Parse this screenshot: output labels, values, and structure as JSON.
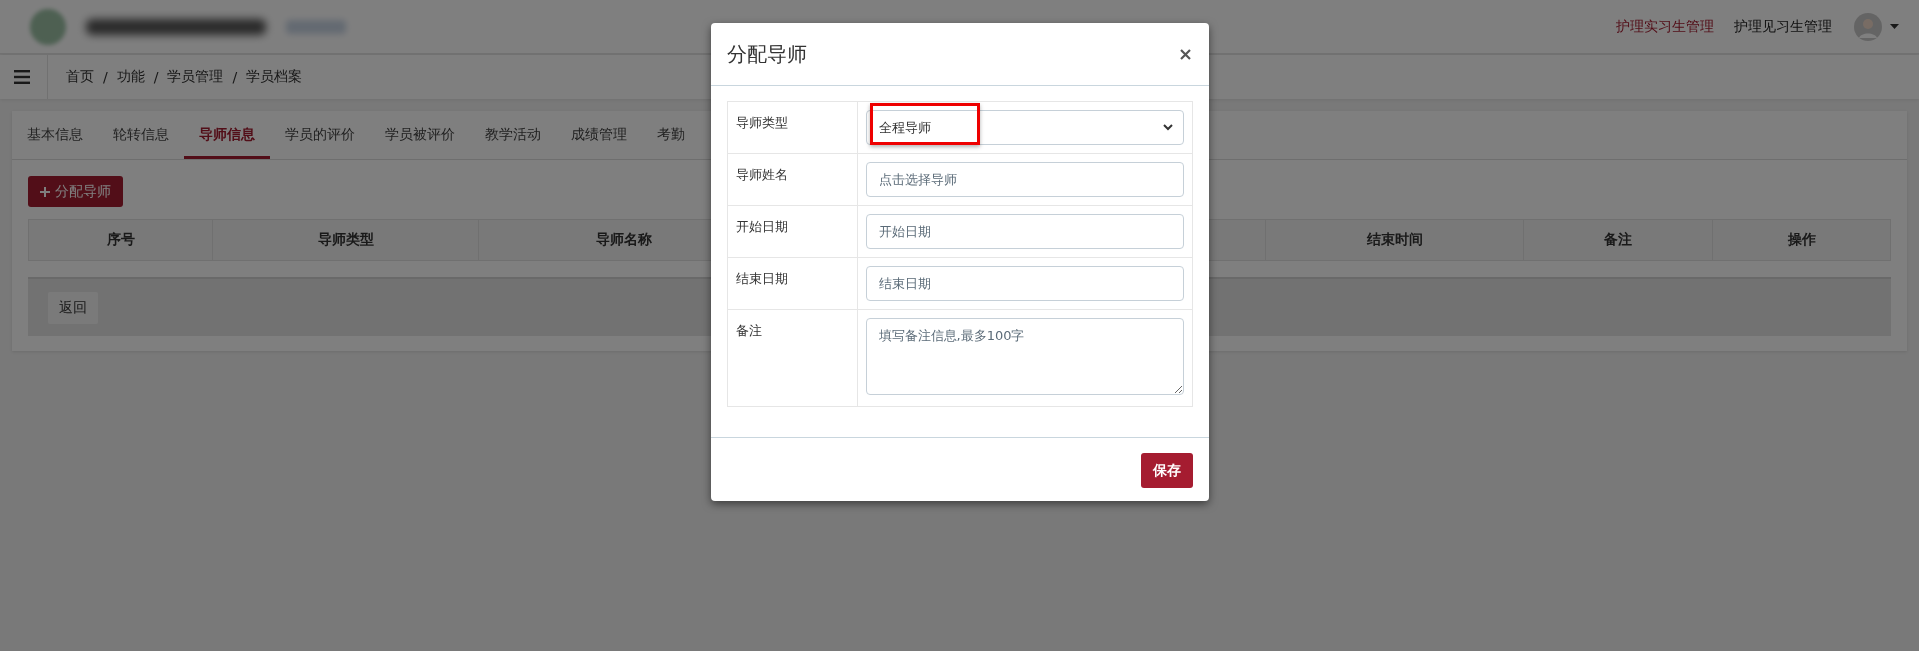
{
  "header": {
    "nav_links": [
      {
        "label": "护理实习生管理",
        "selected": true
      },
      {
        "label": "护理见习生管理",
        "selected": false
      }
    ]
  },
  "breadcrumb": [
    "首页",
    "功能",
    "学员管理",
    "学员档案"
  ],
  "breadcrumb_separator": "/",
  "tabs": [
    {
      "label": "基本信息",
      "selected": false
    },
    {
      "label": "轮转信息",
      "selected": false
    },
    {
      "label": "导师信息",
      "selected": true
    },
    {
      "label": "学员的评价",
      "selected": false
    },
    {
      "label": "学员被评价",
      "selected": false
    },
    {
      "label": "教学活动",
      "selected": false
    },
    {
      "label": "成绩管理",
      "selected": false
    },
    {
      "label": "考勤",
      "selected": false
    }
  ],
  "assign_button": "分配导师",
  "table": {
    "columns": [
      "序号",
      "导师类型",
      "导师名称",
      "结束时间",
      "备注",
      "操作"
    ]
  },
  "back_button": "返回",
  "modal": {
    "title": "分配导师",
    "fields": [
      {
        "label": "导师类型",
        "kind": "select",
        "value": "全程导师",
        "highlighted": true
      },
      {
        "label": "导师姓名",
        "kind": "input",
        "placeholder": "点击选择导师",
        "highlighted": false
      },
      {
        "label": "开始日期",
        "kind": "input",
        "placeholder": "开始日期",
        "highlighted": false
      },
      {
        "label": "结束日期",
        "kind": "input",
        "placeholder": "结束日期",
        "highlighted": false
      },
      {
        "label": "备注",
        "kind": "textarea",
        "placeholder": "填写备注信息,最多100字",
        "highlighted": false
      }
    ],
    "save_button": "保存"
  }
}
